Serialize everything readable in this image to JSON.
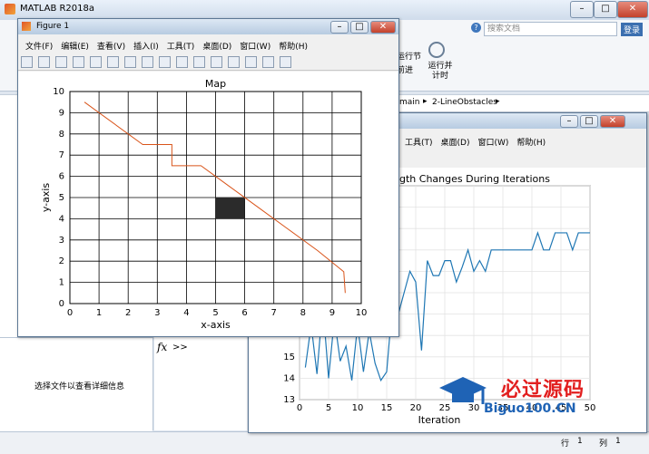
{
  "matlab": {
    "title": "MATLAB R2018a",
    "search_placeholder": "搜索文档",
    "login": "登录",
    "ribbon_run_section": "运行节",
    "ribbon_advance": "前进",
    "ribbon_run_time": "运行并\n计时",
    "breadcrumb": [
      "main",
      "2-LineObstacles"
    ],
    "details_text": "选择文件以查看详细信息",
    "fx_label": "fx",
    "fx_arrows": ">>",
    "status_line": "行",
    "status_line_value": "1",
    "status_col": "列",
    "status_col_value": "1"
  },
  "figure1": {
    "title": "Figure 1",
    "menu": [
      "文件(F)",
      "编辑(E)",
      "查看(V)",
      "插入(I)",
      "工具(T)",
      "桌面(D)",
      "窗口(W)",
      "帮助(H)"
    ],
    "chart_data": {
      "type": "line",
      "title": "Map",
      "xlabel": "x-axis",
      "ylabel": "y-axis",
      "xlim": [
        0,
        10
      ],
      "ylim": [
        0,
        10
      ],
      "xticks": [
        0,
        1,
        2,
        3,
        4,
        5,
        6,
        7,
        8,
        9,
        10
      ],
      "yticks": [
        0,
        1,
        2,
        3,
        4,
        5,
        6,
        7,
        8,
        9,
        10
      ],
      "grid": true,
      "obstacle": {
        "x": [
          5,
          6
        ],
        "y": [
          4,
          5
        ],
        "color": "#2b2b2b"
      },
      "path": {
        "color": "#d9541a",
        "x": [
          0.5,
          2.5,
          3.5,
          3.5,
          4.5,
          5.5,
          6.5,
          7.5,
          8.5,
          9.4,
          9.45
        ],
        "y": [
          9.5,
          7.5,
          7.5,
          6.5,
          6.5,
          5.5,
          4.5,
          3.5,
          2.5,
          1.5,
          0.5
        ]
      }
    }
  },
  "figure2": {
    "menu": [
      "工具(T)",
      "桌面(D)",
      "窗口(W)",
      "帮助(H)"
    ],
    "chart_data": {
      "type": "line",
      "title": "gth Changes During Iterations",
      "xlabel": "Iteration",
      "ylabel": "",
      "xticks": [
        0,
        5,
        10,
        15,
        20,
        25,
        30,
        35,
        40,
        45,
        50
      ],
      "xticklabels": [
        "0",
        "5",
        "10",
        "15",
        "20",
        "25",
        "30",
        "35",
        "40",
        "45",
        "50"
      ],
      "yticks": [
        13,
        14,
        15
      ],
      "xlim": [
        0,
        50
      ],
      "ylim": [
        13,
        23
      ],
      "grid": true,
      "series": [
        {
          "color": "#1f77b4",
          "x": [
            1,
            2,
            3,
            4,
            5,
            6,
            7,
            8,
            9,
            10,
            11,
            12,
            13,
            14,
            15,
            16,
            17,
            18,
            19,
            20,
            21,
            22,
            23,
            24,
            25,
            26,
            27,
            28,
            29,
            30,
            31,
            32,
            33,
            34,
            35,
            36,
            37,
            38,
            39,
            40,
            41,
            42,
            43,
            44,
            45,
            46,
            47,
            48,
            49,
            50
          ],
          "y": [
            14.5,
            16.5,
            14.2,
            17.5,
            14.0,
            16.8,
            14.8,
            15.5,
            13.9,
            16.5,
            14.3,
            16.2,
            14.7,
            13.9,
            14.3,
            17.5,
            17.0,
            18.0,
            19.0,
            18.5,
            15.3,
            19.5,
            18.8,
            18.8,
            19.5,
            19.5,
            18.5,
            19.2,
            20.0,
            19.0,
            19.5,
            19.0,
            20.0,
            20.0,
            20.0,
            20.0,
            20.0,
            20.0,
            20.0,
            20.0,
            20.8,
            20.0,
            20.0,
            20.8,
            20.8,
            20.8,
            20.0,
            20.8,
            20.8,
            20.8
          ]
        }
      ]
    }
  },
  "watermark": "Biguo100.CN",
  "watermark_cn": "必过源码"
}
